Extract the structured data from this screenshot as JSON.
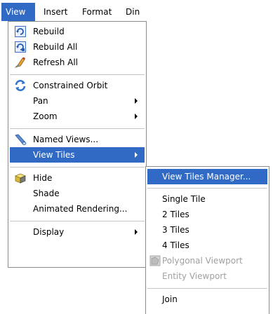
{
  "menubar": {
    "items": [
      {
        "label": "View"
      },
      {
        "label": "Insert"
      },
      {
        "label": "Format"
      },
      {
        "label": "Din"
      }
    ]
  },
  "view_menu": {
    "items": [
      {
        "label": "Rebuild",
        "icon": "rebuild-icon"
      },
      {
        "label": "Rebuild All",
        "icon": "rebuild-all-icon"
      },
      {
        "label": "Refresh All",
        "icon": "refresh-all-icon"
      },
      {
        "label": "Constrained Orbit",
        "icon": "constrained-orbit-icon"
      },
      {
        "label": "Pan",
        "submenu": true
      },
      {
        "label": "Zoom",
        "submenu": true
      },
      {
        "label": "Named Views...",
        "icon": "named-views-icon"
      },
      {
        "label": "View Tiles",
        "submenu": true,
        "selected": true
      },
      {
        "label": "Hide",
        "icon": "hide-icon"
      },
      {
        "label": "Shade"
      },
      {
        "label": "Animated Rendering..."
      },
      {
        "label": "Display",
        "submenu": true
      }
    ]
  },
  "view_tiles_submenu": {
    "items": [
      {
        "label": "View Tiles Manager...",
        "selected": true
      },
      {
        "label": "Single Tile"
      },
      {
        "label": "2 Tiles"
      },
      {
        "label": "3 Tiles"
      },
      {
        "label": "4 Tiles"
      },
      {
        "label": "Polygonal Viewport",
        "disabled": true,
        "icon": "polygonal-viewport-icon"
      },
      {
        "label": "Entity Viewport",
        "disabled": true
      },
      {
        "label": "Join"
      }
    ]
  },
  "colors": {
    "highlight": "#316ac5",
    "highlight_text": "#ffffff",
    "disabled_text": "#a0a0a0",
    "menu_border": "#8a8a8a",
    "separator": "#c5c5c5"
  }
}
